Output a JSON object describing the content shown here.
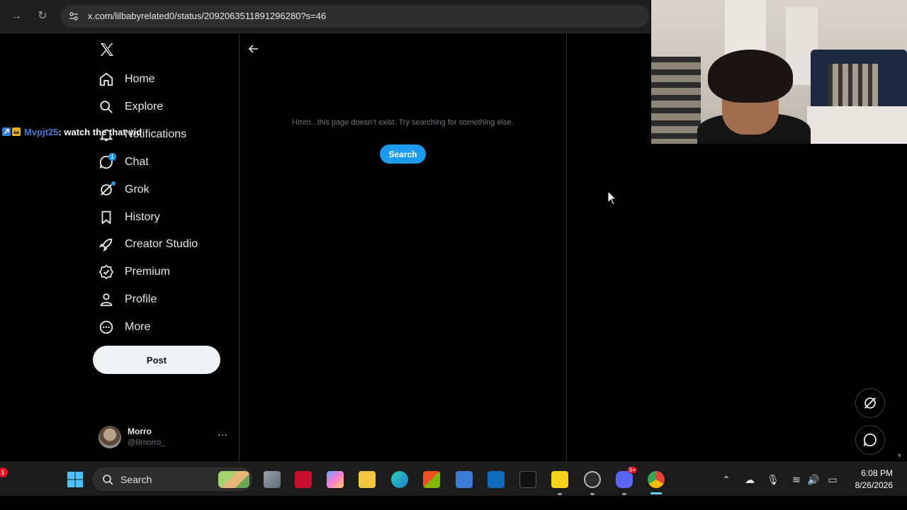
{
  "browser": {
    "url": "x.com/lilbabyrelated0/status/2092063511891296280?s=46",
    "forward_glyph": "→",
    "reload_glyph": "↻"
  },
  "sidebar": {
    "items": [
      {
        "label": "Home",
        "icon": "home-icon"
      },
      {
        "label": "Explore",
        "icon": "search-icon"
      },
      {
        "label": "Notifications",
        "icon": "bell-icon"
      },
      {
        "label": "Chat",
        "icon": "chat-icon",
        "badge": "1"
      },
      {
        "label": "Grok",
        "icon": "grok-icon"
      },
      {
        "label": "History",
        "icon": "bookmark-icon"
      },
      {
        "label": "Creator Studio",
        "icon": "rocket-icon"
      },
      {
        "label": "Premium",
        "icon": "verified-icon"
      },
      {
        "label": "Profile",
        "icon": "person-icon"
      },
      {
        "label": "More",
        "icon": "more-circle-icon"
      }
    ],
    "post_label": "Post",
    "account": {
      "name": "Morro",
      "handle": "@lilmorro_",
      "more": "···"
    }
  },
  "chat_overlay": {
    "user": "Mvpjt25",
    "message": ": watch the that vid"
  },
  "main": {
    "error_message": "Hmm...this page doesn’t exist. Try searching for something else.",
    "search_label": "Search"
  },
  "taskbar": {
    "search_label": "Search",
    "time": "6:08 PM",
    "date": "8/26/2026",
    "notification_count": "1",
    "discord_badge": "9+"
  },
  "colors": {
    "accent": "#1d9bf0",
    "background": "#000000",
    "text": "#e7e9ea",
    "muted": "#71767b",
    "chat_username": "#4b7bd9"
  }
}
